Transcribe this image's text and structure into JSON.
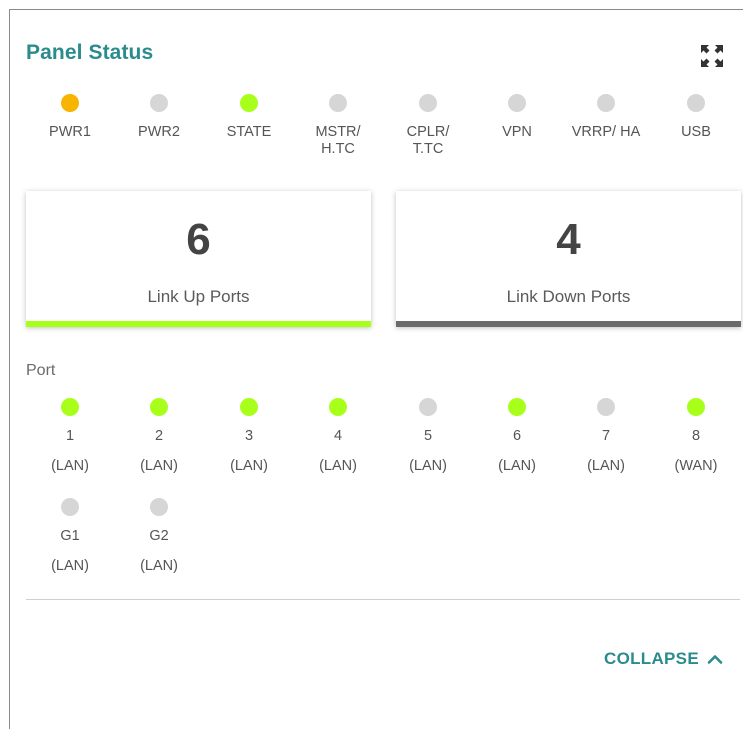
{
  "panel": {
    "title": "Panel Status"
  },
  "indicators": [
    {
      "label": "PWR1",
      "status": "amber"
    },
    {
      "label": "PWR2",
      "status": "off"
    },
    {
      "label": "STATE",
      "status": "green"
    },
    {
      "label": "MSTR/\nH.TC",
      "status": "off"
    },
    {
      "label": "CPLR/\nT.TC",
      "status": "off"
    },
    {
      "label": "VPN",
      "status": "off"
    },
    {
      "label": "VRRP/ HA",
      "status": "off"
    },
    {
      "label": "USB",
      "status": "off"
    }
  ],
  "summary": {
    "link_up": {
      "count": "6",
      "label": "Link Up Ports",
      "bar_color": "#a8ff1a"
    },
    "link_down": {
      "count": "4",
      "label": "Link Down Ports",
      "bar_color": "#6b6b6b"
    }
  },
  "ports": {
    "heading": "Port",
    "items": [
      {
        "id": "1",
        "type": "(LAN)",
        "status": "green"
      },
      {
        "id": "2",
        "type": "(LAN)",
        "status": "green"
      },
      {
        "id": "3",
        "type": "(LAN)",
        "status": "green"
      },
      {
        "id": "4",
        "type": "(LAN)",
        "status": "green"
      },
      {
        "id": "5",
        "type": "(LAN)",
        "status": "off"
      },
      {
        "id": "6",
        "type": "(LAN)",
        "status": "green"
      },
      {
        "id": "7",
        "type": "(LAN)",
        "status": "off"
      },
      {
        "id": "8",
        "type": "(WAN)",
        "status": "green"
      },
      {
        "id": "G1",
        "type": "(LAN)",
        "status": "off"
      },
      {
        "id": "G2",
        "type": "(LAN)",
        "status": "off"
      }
    ]
  },
  "footer": {
    "collapse_label": "COLLAPSE",
    "collapse_icon": "chevron-up-icon"
  },
  "colors": {
    "accent": "#2a8c8c",
    "led_green": "#a8ff1a",
    "led_amber": "#f7b500",
    "led_off": "#d6d6d6"
  }
}
